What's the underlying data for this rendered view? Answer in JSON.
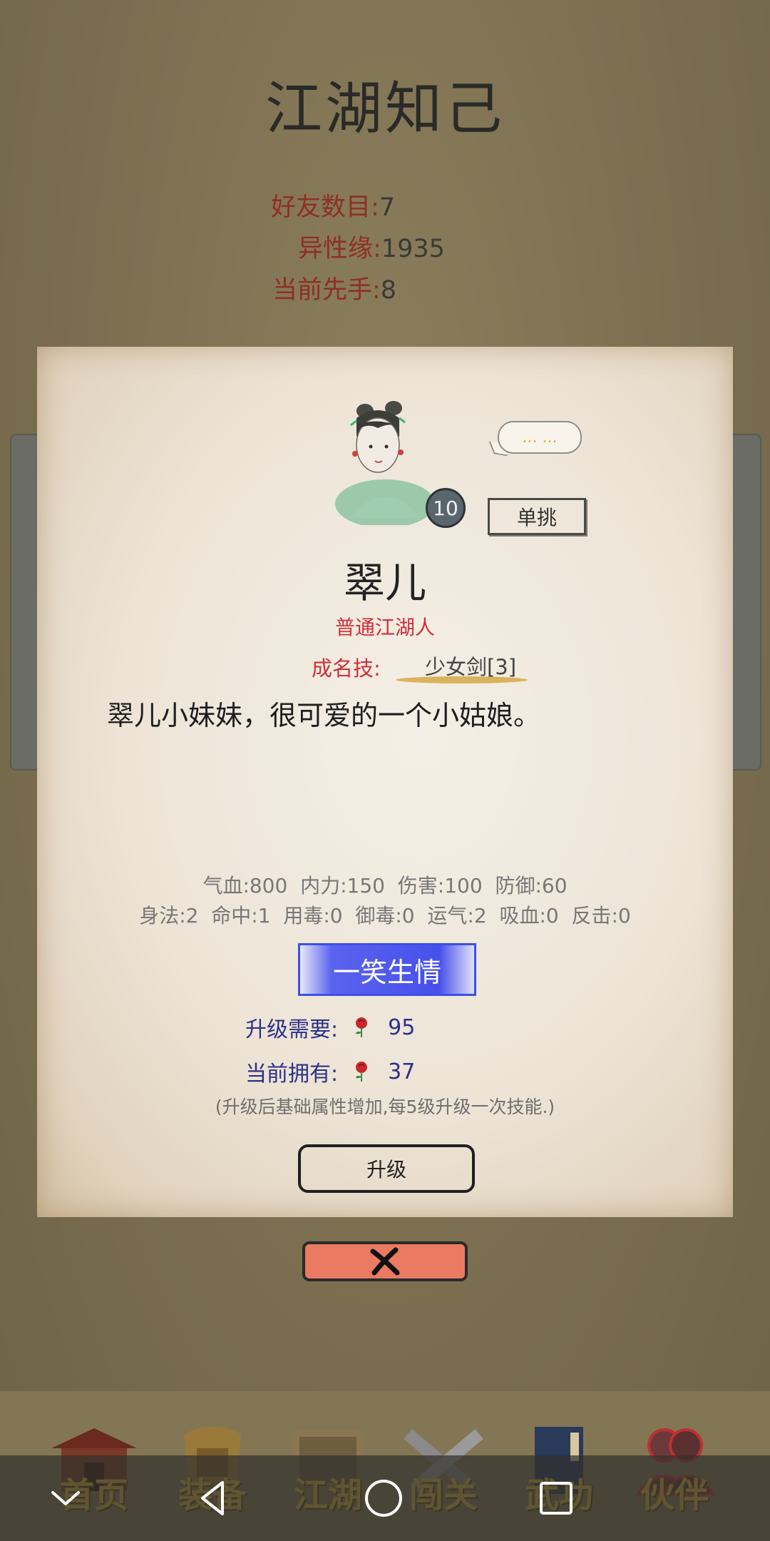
{
  "header": {
    "title": "江湖知己"
  },
  "stats": {
    "friends_label": "好友数目:",
    "friends_value": "7",
    "affinity_label": "异性缘:",
    "affinity_value": "1935",
    "initiative_label": "当前先手:",
    "initiative_value": "8"
  },
  "companion": {
    "speech_bubble": "... ...",
    "level": "10",
    "duel_label": "单挑",
    "name": "翠儿",
    "rank": "普通江湖人",
    "signature_skill_label": "成名技:",
    "signature_skill": "少女剑[3]",
    "description": "翠儿小妹妹，很可爱的一个小姑娘。",
    "attributes_line1": "气血:800  内力:150  伤害:100  防御:60",
    "attributes_line2": "身法:2  命中:1  用毒:0  御毒:0  运气:2  吸血:0  反击:0",
    "ability": "一笑生情",
    "upgrade_need_label": "升级需要:",
    "upgrade_need_value": "95",
    "owned_label": "当前拥有:",
    "owned_value": "37",
    "upgrade_note": "(升级后基础属性增加,每5级升级一次技能.)",
    "upgrade_button": "升级"
  },
  "bottom_nav": {
    "tabs": [
      {
        "label": "首页",
        "icon": "house-icon"
      },
      {
        "label": "装备",
        "icon": "armor-icon"
      },
      {
        "label": "江湖",
        "icon": "scroll-map-icon"
      },
      {
        "label": "闯关",
        "icon": "crossed-swords-icon"
      },
      {
        "label": "武功",
        "icon": "book-icon"
      },
      {
        "label": "伙伴",
        "icon": "partners-icon"
      }
    ]
  },
  "colors": {
    "accent_red": "#d12f3a",
    "ability_blue": "#4750eb",
    "close_button": "#ea7a62"
  }
}
